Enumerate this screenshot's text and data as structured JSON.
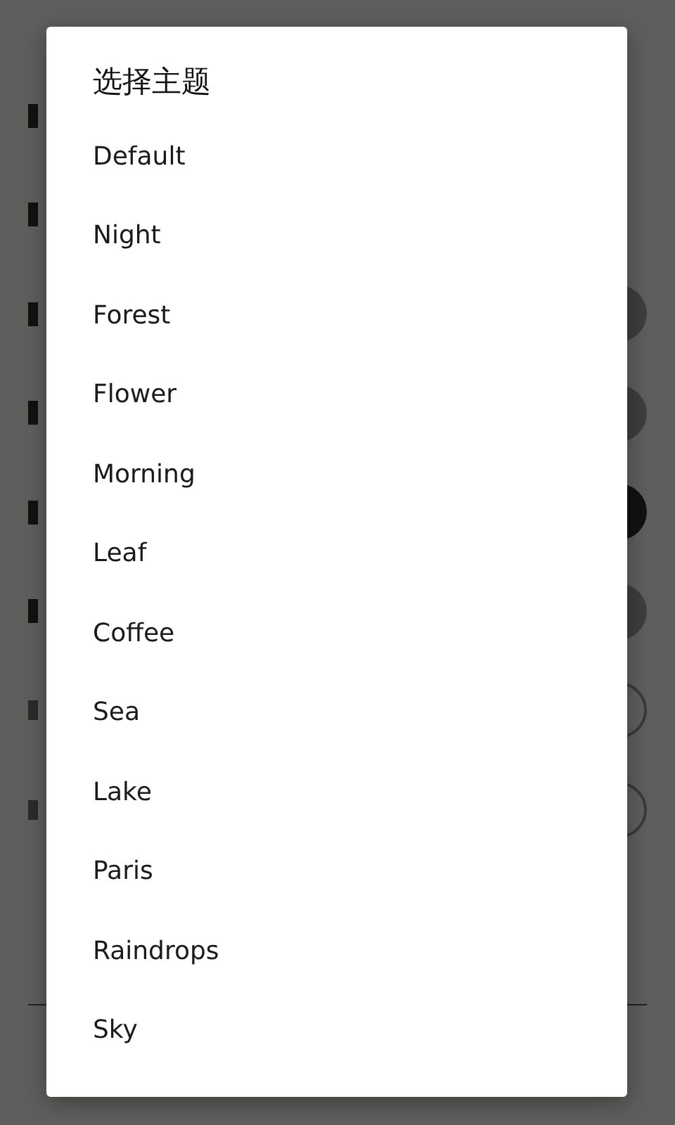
{
  "dialog": {
    "title": "选择主题",
    "items": [
      "Default",
      "Night",
      "Forest",
      "Flower",
      "Morning",
      "Leaf",
      "Coffee",
      "Sea",
      "Lake",
      "Paris",
      "Raindrops",
      "Sky"
    ]
  }
}
